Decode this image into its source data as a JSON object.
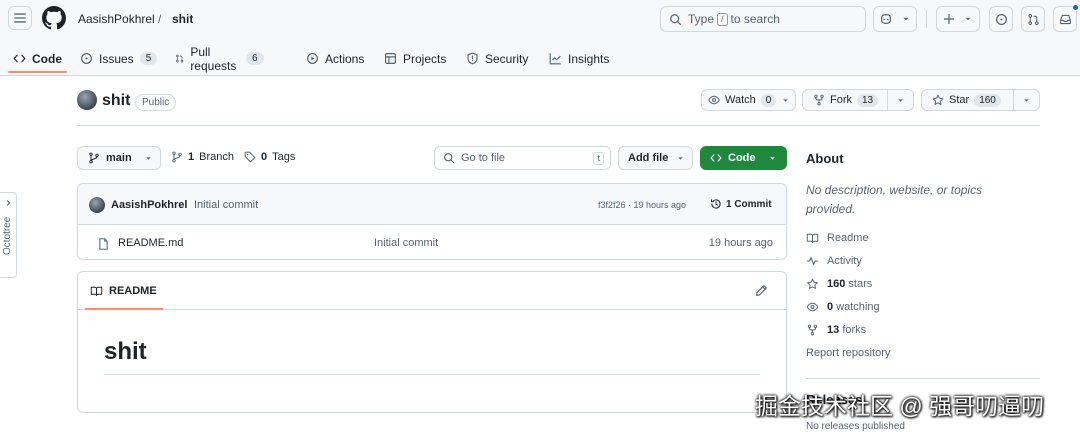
{
  "header": {
    "owner": "AasishPokhrel",
    "separator": "/",
    "repo": "shit",
    "search": {
      "prefix": "Type",
      "key": "/",
      "suffix": "to search"
    }
  },
  "nav": {
    "tabs": [
      {
        "label": "Code",
        "icon": "code-icon",
        "active": true
      },
      {
        "label": "Issues",
        "icon": "issue-icon",
        "count": "5"
      },
      {
        "label": "Pull requests",
        "icon": "pull-request-icon",
        "count": "6"
      },
      {
        "label": "Actions",
        "icon": "play-icon"
      },
      {
        "label": "Projects",
        "icon": "table-icon"
      },
      {
        "label": "Security",
        "icon": "shield-icon"
      },
      {
        "label": "Insights",
        "icon": "graph-icon"
      }
    ]
  },
  "repo_header": {
    "name": "shit",
    "visibility": "Public",
    "watch": {
      "label": "Watch",
      "count": "0"
    },
    "fork": {
      "label": "Fork",
      "count": "13"
    },
    "star": {
      "label": "Star",
      "count": "160"
    }
  },
  "file_nav": {
    "branch": "main",
    "branch_count": "1",
    "branch_label": "Branch",
    "tag_count": "0",
    "tag_label": "Tags",
    "goto_placeholder": "Go to file",
    "goto_key": "t",
    "add_file": "Add file",
    "code": "Code"
  },
  "commit": {
    "author": "AasishPokhrel",
    "message": "Initial commit",
    "hash_time": "f3f2f26 · 19 hours ago",
    "commits": "1 Commit"
  },
  "files": [
    {
      "name": "README.md",
      "message": "Initial commit",
      "time": "19 hours ago"
    }
  ],
  "readme": {
    "tab": "README",
    "heading": "shit"
  },
  "sidebar": {
    "about_title": "About",
    "description": "No description, website, or topics provided.",
    "links": {
      "readme": "Readme",
      "activity": "Activity",
      "stars_count": "160",
      "stars_label": "stars",
      "watching_count": "0",
      "watching_label": "watching",
      "forks_count": "13",
      "forks_label": "forks",
      "report": "Report repository"
    },
    "releases_title": "Releases",
    "no_releases": "No releases published"
  },
  "octotree": {
    "label": "Octotree"
  },
  "watermark": "掘金技术社区 @ 强哥叨逼叨",
  "colors": {
    "accent_underline": "#fd8c73",
    "code_button": "#1f883d",
    "border": "#d1d9e0",
    "muted_text": "#59636e",
    "notification_dot": "#0969da"
  }
}
